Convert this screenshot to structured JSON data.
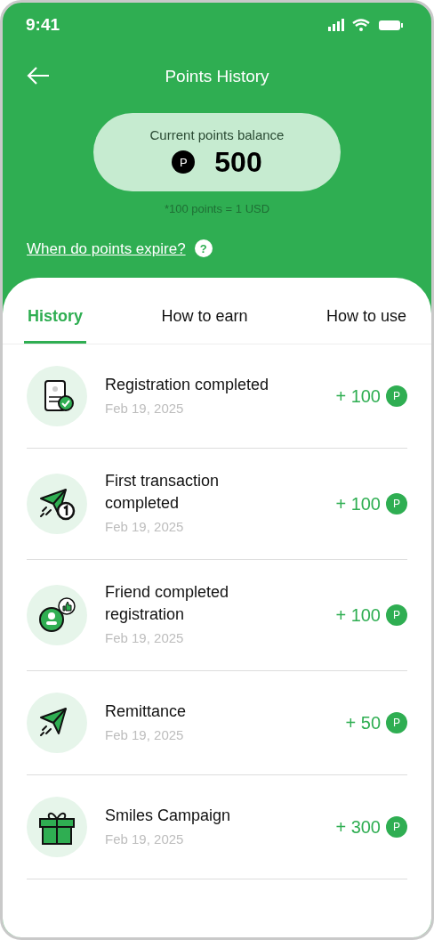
{
  "status_bar": {
    "time": "9:41"
  },
  "header": {
    "title": "Points History"
  },
  "balance": {
    "label": "Current points balance",
    "coin": "P",
    "value": "500",
    "note": "*100 points = 1 USD"
  },
  "expiry_link": {
    "text": "When do points expire?",
    "help": "?"
  },
  "tabs": [
    {
      "label": "History",
      "selected": true
    },
    {
      "label": "How to earn",
      "selected": false
    },
    {
      "label": "How to use",
      "selected": false
    }
  ],
  "history": [
    {
      "kind": "registration",
      "title": "Registration completed",
      "date": "Feb 19, 2025",
      "points": "+ 100",
      "coin": "P"
    },
    {
      "kind": "first_transaction",
      "title": "First transaction completed",
      "date": "Feb 19, 2025",
      "points": "+ 100",
      "coin": "P"
    },
    {
      "kind": "friend",
      "title": "Friend completed registration",
      "date": "Feb 19, 2025",
      "points": "+ 100",
      "coin": "P"
    },
    {
      "kind": "remittance",
      "title": "Remittance",
      "date": "Feb 19, 2025",
      "points": "+ 50",
      "coin": "P"
    },
    {
      "kind": "gift",
      "title": "Smiles Campaign",
      "date": "Feb 19, 2025",
      "points": "+ 300",
      "coin": "P"
    }
  ]
}
